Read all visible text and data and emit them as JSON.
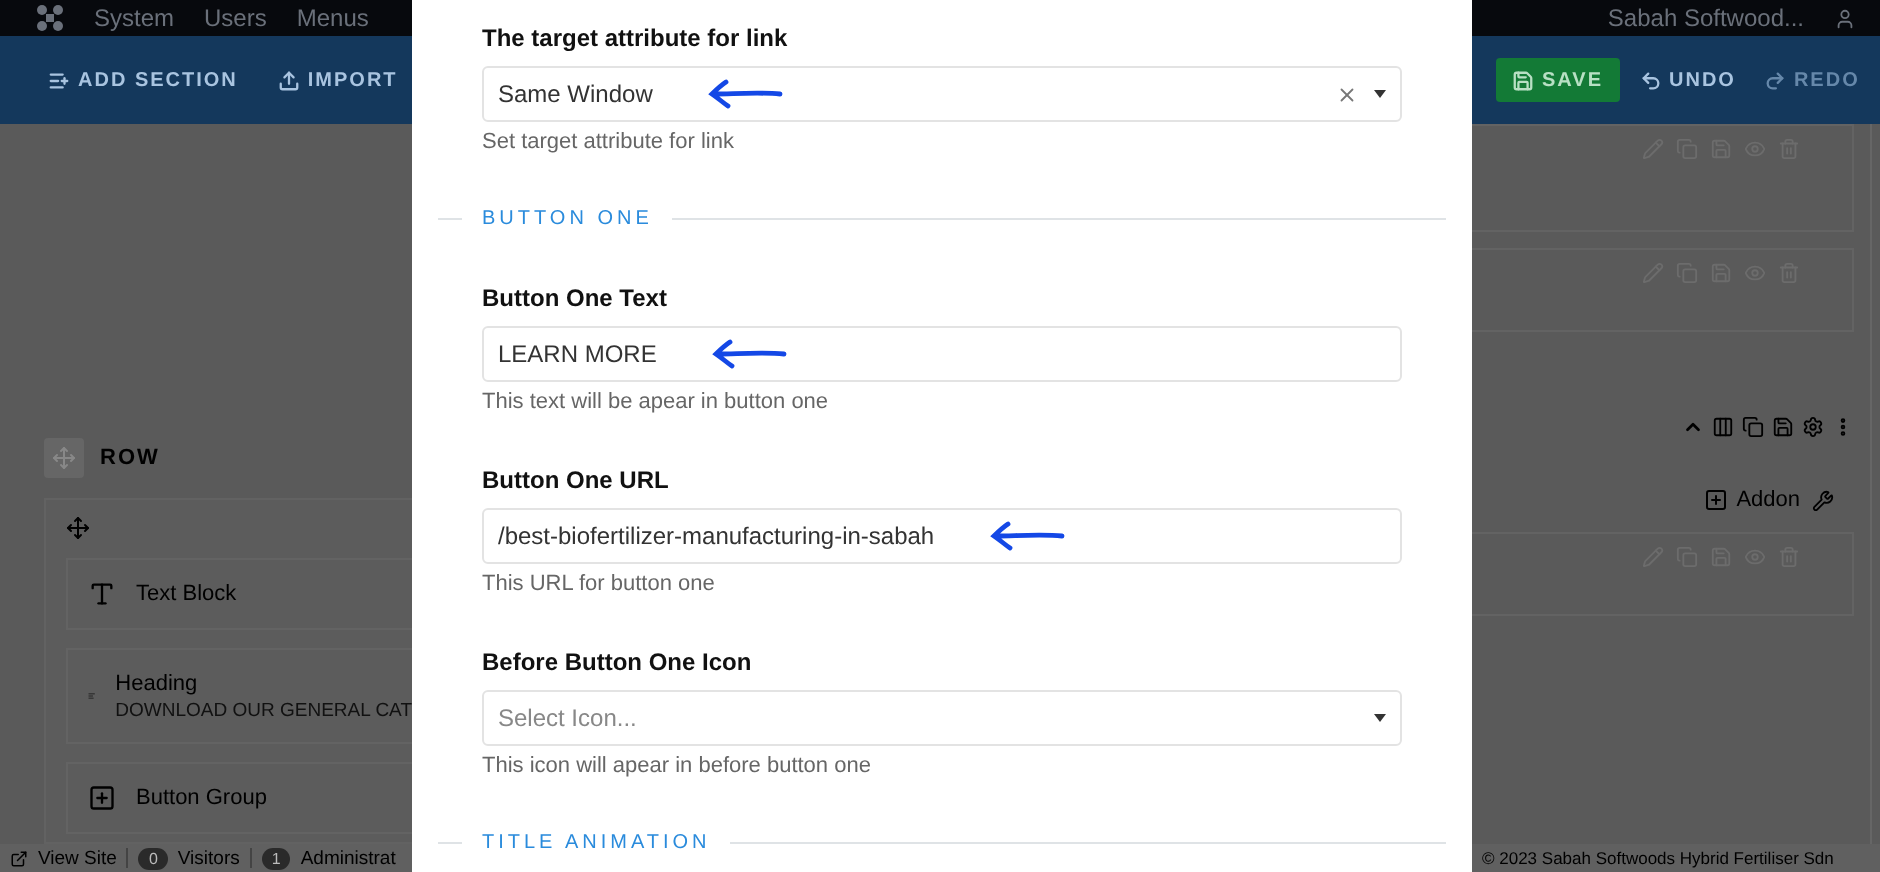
{
  "topbar": {
    "menu": [
      "System",
      "Users",
      "Menus"
    ],
    "site": "Sabah Softwood..."
  },
  "toolbar": {
    "left": [
      {
        "label": "ADD SECTION",
        "kind": "add"
      },
      {
        "label": "IMPORT",
        "kind": "import"
      }
    ],
    "right": [
      {
        "label": "SAVE",
        "kind": "save",
        "disabled": false
      },
      {
        "label": "UNDO",
        "kind": "undo",
        "disabled": false
      },
      {
        "label": "REDO",
        "kind": "redo",
        "disabled": true
      }
    ]
  },
  "row": {
    "title": "ROW",
    "addon_button": "Addon",
    "addons": [
      {
        "name": "Text Block",
        "kind": "text"
      },
      {
        "name": "Heading",
        "kind": "heading",
        "subtitle": "DOWNLOAD OUR GENERAL CAT"
      },
      {
        "name": "Button Group",
        "kind": "buttons"
      }
    ]
  },
  "modal": {
    "items": [
      {
        "kind": "select",
        "label": "The target attribute for link",
        "value": "Same Window",
        "clearable": true,
        "help": "Set target attribute for link",
        "annotated": true
      },
      {
        "kind": "section",
        "title": "BUTTON ONE"
      },
      {
        "kind": "text",
        "label": "Button One Text",
        "value": "LEARN MORE",
        "help": "This text will be apear in button one",
        "annotated": true
      },
      {
        "kind": "text",
        "label": "Button One URL",
        "value": "/best-biofertilizer-manufacturing-in-sabah",
        "help": "This URL for button one",
        "annotated": true
      },
      {
        "kind": "select",
        "label": "Before Button One Icon",
        "placeholder": "Select Icon...",
        "clearable": false,
        "help": "This icon will apear in before button one",
        "annotated": false
      },
      {
        "kind": "section",
        "title": "TITLE ANIMATION"
      }
    ]
  },
  "footer": {
    "view_site": "View Site",
    "visitors_count": "0",
    "visitors": "Visitors",
    "admins_count": "1",
    "admins": "Administrat",
    "copyright": "© 2023 Sabah Softwoods Hybrid Fertiliser Sdn"
  }
}
